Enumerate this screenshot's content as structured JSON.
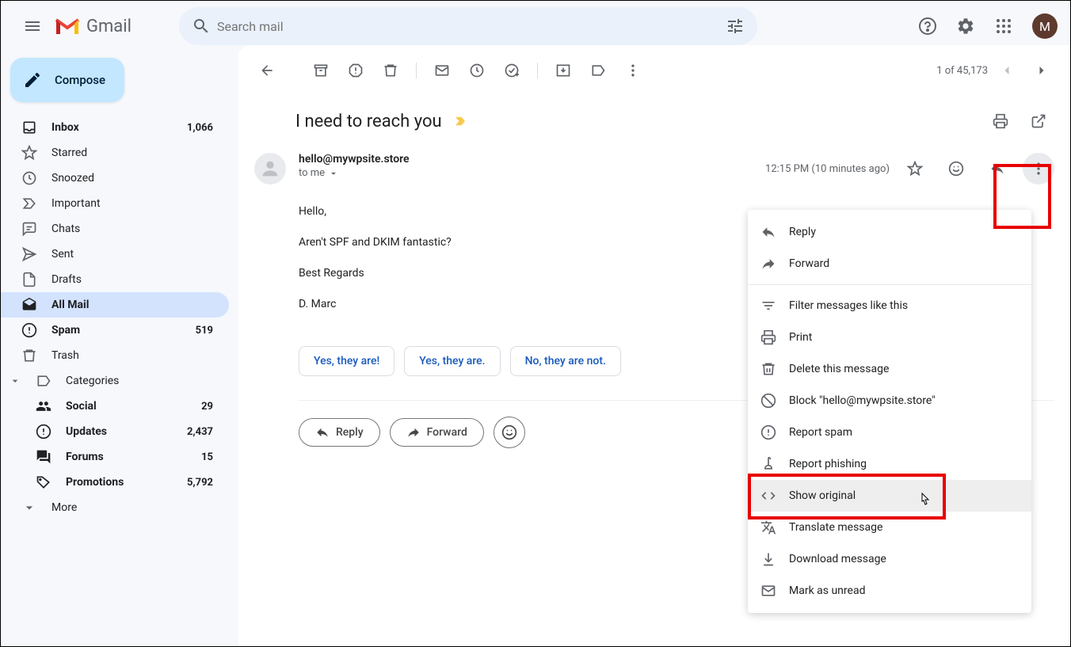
{
  "header": {
    "app_name": "Gmail",
    "search_placeholder": "Search mail",
    "avatar_letter": "M"
  },
  "sidebar": {
    "compose_label": "Compose",
    "items": [
      {
        "label": "Inbox",
        "count": "1,066",
        "bold": true
      },
      {
        "label": "Starred"
      },
      {
        "label": "Snoozed"
      },
      {
        "label": "Important"
      },
      {
        "label": "Chats"
      },
      {
        "label": "Sent"
      },
      {
        "label": "Drafts"
      },
      {
        "label": "All Mail",
        "active": true
      },
      {
        "label": "Spam",
        "count": "519",
        "bold": true
      },
      {
        "label": "Trash"
      },
      {
        "label": "Categories"
      }
    ],
    "categories": [
      {
        "label": "Social",
        "count": "29",
        "bold": true
      },
      {
        "label": "Updates",
        "count": "2,437",
        "bold": true
      },
      {
        "label": "Forums",
        "count": "15",
        "bold": true
      },
      {
        "label": "Promotions",
        "count": "5,792",
        "bold": true
      }
    ],
    "more_label": "More"
  },
  "toolbar": {
    "pagination": "1 of 45,173"
  },
  "email": {
    "subject": "I need to reach you",
    "sender": "hello@mywpsite.store",
    "to": "to me",
    "timestamp": "12:15 PM (10 minutes ago)",
    "body": {
      "line1": "Hello,",
      "line2": "Aren't SPF and DKIM fantastic?",
      "line3": "Best Regards",
      "line4": "D. Marc"
    },
    "suggestions": [
      "Yes, they are!",
      "Yes, they are.",
      "No, they are not."
    ],
    "reply_label": "Reply",
    "forward_label": "Forward"
  },
  "menu": {
    "items": [
      {
        "label": "Reply",
        "icon": "reply"
      },
      {
        "label": "Forward",
        "icon": "forward"
      },
      {
        "sep": true
      },
      {
        "label": "Filter messages like this",
        "icon": "filter"
      },
      {
        "label": "Print",
        "icon": "print"
      },
      {
        "label": "Delete this message",
        "icon": "delete"
      },
      {
        "label": "Block \"hello@mywpsite.store\"",
        "icon": "block"
      },
      {
        "label": "Report spam",
        "icon": "spam"
      },
      {
        "label": "Report phishing",
        "icon": "phishing"
      },
      {
        "label": "Show original",
        "icon": "code",
        "hover": true
      },
      {
        "label": "Translate message",
        "icon": "translate"
      },
      {
        "label": "Download message",
        "icon": "download"
      },
      {
        "label": "Mark as unread",
        "icon": "unread"
      }
    ]
  }
}
